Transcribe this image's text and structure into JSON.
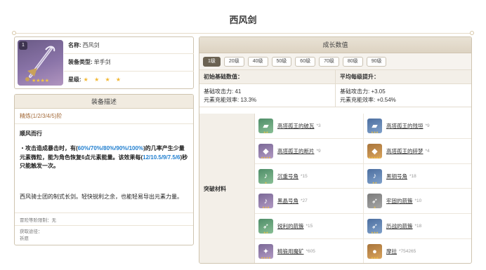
{
  "page": {
    "title": "西风剑"
  },
  "info": {
    "refine_level": "1",
    "name_label": "名称:",
    "name_value": "西风剑",
    "type_label": "装备类型:",
    "type_value": "单手剑",
    "rarity_label": "星级:",
    "rarity_stars": "★ ★ ★ ★",
    "icon_stars": "★★★★"
  },
  "description": {
    "header": "装备描述",
    "refinement": "精炼(1/2/3/4/5)阶",
    "skill_name": "顺风而行",
    "skill_p1": "・攻击造成暴击时，有(",
    "skill_v1": "60%/70%/80%/90%/100%",
    "skill_p2": ")的几率产生少量元素微粒，能为角色恢复6点元素能量。该效果每(",
    "skill_v2": "12/10.5/9/7.5/6",
    "skill_p3": ")秒只能触发一次。",
    "lore": "西风骑士团的制式长剑。轻快锐利之余，也能轻易导出元素力量。",
    "ascension_limit": "冒险等阶限制：无",
    "source_label": "获取途径：",
    "source_value": "祈愿"
  },
  "growth": {
    "header": "成长数值",
    "levels": [
      "1级",
      "20级",
      "40级",
      "50级",
      "60级",
      "70级",
      "80级",
      "90级"
    ],
    "active_level": "1级",
    "base_header": "初始基础数值：",
    "avg_header": "平均每级提升：",
    "base_atk": "基础攻击力: 41",
    "base_er": "元素充能效率: 13.3%",
    "avg_atk": "基础攻击力: +3.05",
    "avg_er": "元素充能效率: +0.54%",
    "materials_label": "突破材料",
    "materials": [
      {
        "name": "高塔孤王的破瓦",
        "count": "*3",
        "icon": "tile-icon"
      },
      {
        "name": "高塔孤王的残垣",
        "count": "*9",
        "icon": "wall-icon"
      },
      {
        "name": "高塔孤王的断片",
        "count": "*9",
        "icon": "fragment-icon"
      },
      {
        "name": "高塔孤王的碎梦",
        "count": "*4",
        "icon": "dream-icon"
      },
      {
        "name": "沉重号角",
        "count": "*15",
        "icon": "horn-icon"
      },
      {
        "name": "黑铜号角",
        "count": "*18",
        "icon": "bronze-horn-icon"
      },
      {
        "name": "黑晶号角",
        "count": "*27",
        "icon": "crystal-horn-icon"
      },
      {
        "name": "牢固的箭簇",
        "count": "*10",
        "icon": "arrowhead-icon"
      },
      {
        "name": "锐利的箭簇",
        "count": "*15",
        "icon": "sharp-arrowhead-icon"
      },
      {
        "name": "历战的箭簇",
        "count": "*18",
        "icon": "veteran-arrowhead-icon"
      },
      {
        "name": "精锻用魔矿",
        "count": "*605",
        "icon": "ore-icon"
      },
      {
        "name": "摩拉",
        "count": "*754265",
        "icon": "mora-icon"
      }
    ]
  }
}
